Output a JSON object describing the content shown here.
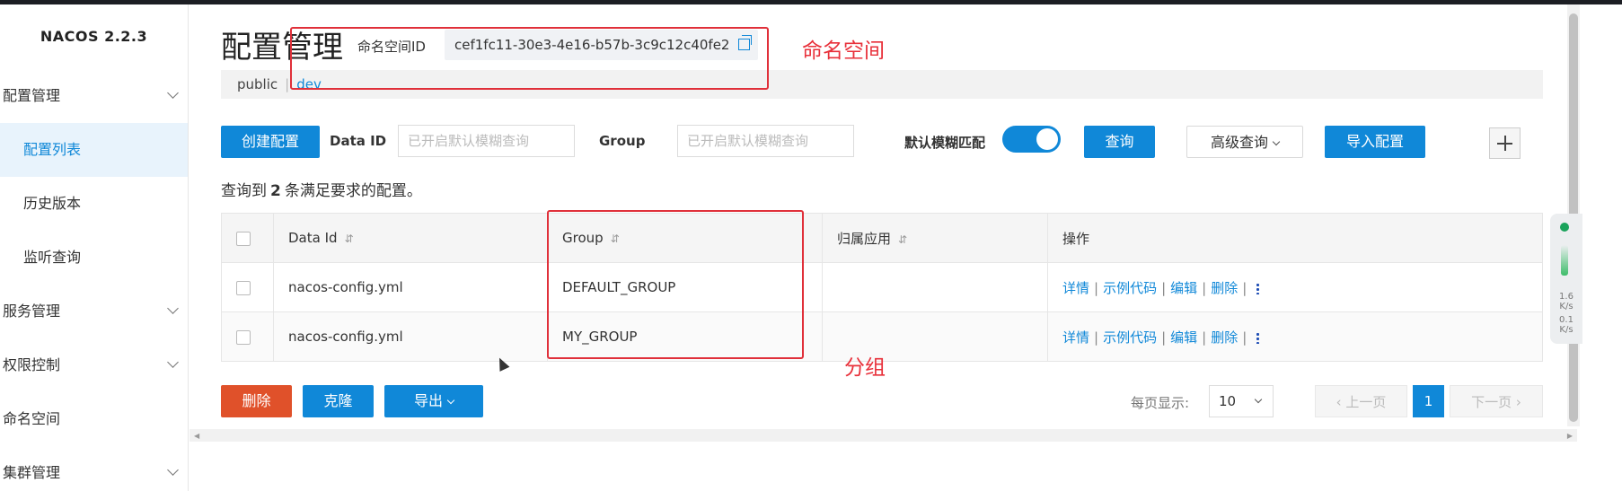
{
  "app": {
    "brand": "NACOS 2.2.3"
  },
  "sidebar": {
    "items": [
      {
        "label": "配置管理",
        "expandable": true
      },
      {
        "label": "配置列表",
        "sub": true,
        "active": true
      },
      {
        "label": "历史版本",
        "sub": true
      },
      {
        "label": "监听查询",
        "sub": true
      },
      {
        "label": "服务管理",
        "expandable": true
      },
      {
        "label": "权限控制",
        "expandable": true
      },
      {
        "label": "命名空间",
        "expandable": false
      },
      {
        "label": "集群管理",
        "expandable": true
      }
    ]
  },
  "header": {
    "title": "配置管理",
    "namespace_label": "命名空间ID",
    "namespace_id": "cef1fc11-30e3-4e16-b57b-3c9c12c40fe2",
    "ns_tabs": [
      "public",
      "|",
      "dev"
    ]
  },
  "toolbar": {
    "create": "创建配置",
    "data_id_label": "Data ID",
    "data_id_placeholder": "已开启默认模糊查询",
    "group_label": "Group",
    "group_placeholder": "已开启默认模糊查询",
    "fuzzy_label": "默认模糊匹配",
    "fuzzy_on": true,
    "query": "查询",
    "advanced": "高级查询",
    "import": "导入配置"
  },
  "summary": {
    "prefix": "查询到",
    "count": "2",
    "suffix": "条满足要求的配置。"
  },
  "table": {
    "columns": [
      "Data Id",
      "Group",
      "归属应用",
      "操作"
    ],
    "sort_icon": "⇵",
    "rows": [
      {
        "data_id": "nacos-config.yml",
        "group": "DEFAULT_GROUP",
        "app": ""
      },
      {
        "data_id": "nacos-config.yml",
        "group": "MY_GROUP",
        "app": ""
      }
    ],
    "ops": [
      "详情",
      "示例代码",
      "编辑",
      "删除"
    ],
    "op_sep": "|"
  },
  "footer": {
    "delete": "删除",
    "clone": "克隆",
    "export": "导出",
    "page_size_label": "每页显示:",
    "page_size": "10",
    "prev": "上一页",
    "current_page": "1",
    "next": "下一页"
  },
  "widget": {
    "up": "1.6",
    "up_unit": "K/s",
    "down": "0.1",
    "down_unit": "K/s"
  },
  "annotations": {
    "namespace": "命名空间",
    "group": "分组"
  },
  "colors": {
    "accent": "#1088d8",
    "danger": "#e0512a",
    "annotation": "#e0303a"
  }
}
